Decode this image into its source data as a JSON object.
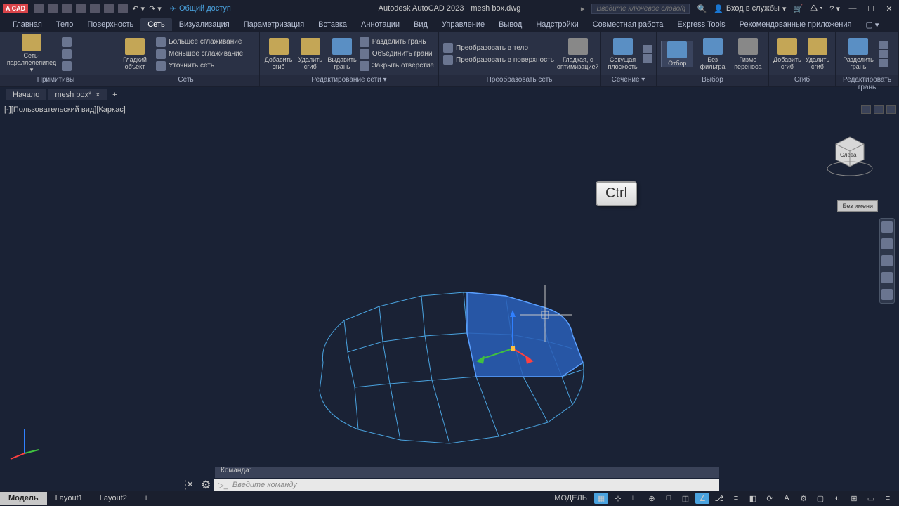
{
  "app": {
    "name": "Autodesk AutoCAD 2023",
    "file": "mesh box.dwg",
    "badge": "A CAD",
    "share": "Общий доступ",
    "search_placeholder": "Введите ключевое слово/фразу",
    "signin": "Вход в службы"
  },
  "ribbon_tabs": [
    "Главная",
    "Тело",
    "Поверхность",
    "Сеть",
    "Визуализация",
    "Параметризация",
    "Вставка",
    "Аннотации",
    "Вид",
    "Управление",
    "Вывод",
    "Надстройки",
    "Совместная работа",
    "Express Tools",
    "Рекомендованные приложения"
  ],
  "active_tab": 3,
  "panels": {
    "primitives": {
      "title": "Примитивы",
      "main_btn": "Сеть-параллелепипед"
    },
    "mesh": {
      "title": "Сеть",
      "smooth_obj": "Гладкий объект",
      "more": "Большее сглаживание",
      "less": "Меньшее сглаживание",
      "refine": "Уточнить сеть"
    },
    "edit": {
      "title": "Редактирование сети ▾",
      "add_crease": "Добавить сгиб",
      "del_crease": "Удалить сгиб",
      "extrude": "Выдавить грань",
      "split": "Разделить грань",
      "merge": "Объединить грани",
      "close_hole": "Закрыть отверстие"
    },
    "convert": {
      "title": "Преобразовать сеть",
      "smooth_opt": "Гладкая, с оптимизацией",
      "section": "Секущая плоскость",
      "to_solid": "Преобразовать в тело",
      "to_surf": "Преобразовать в поверхность"
    },
    "section_panel": {
      "title": "Сечение ▾"
    },
    "selection": {
      "title": "Выбор",
      "filter": "Отбор",
      "nofilter": "Без фильтра",
      "gizmo": "Гизмо переноса"
    },
    "crease": {
      "title": "Сгиб",
      "add": "Добавить сгиб",
      "del": "Удалить сгиб"
    },
    "edit_face": {
      "title": "Редактировать грань",
      "split": "Разделить грань"
    }
  },
  "doc_tabs": {
    "start": "Начало",
    "current": "mesh box*"
  },
  "viewport": {
    "label": "[-][Пользовательский вид][Каркас]",
    "cube_face": "Слева",
    "unnamed": "Без имени"
  },
  "key_hint": "Ctrl",
  "cmd": {
    "history": "Команда:",
    "placeholder": "Введите команду"
  },
  "layouts": [
    "Модель",
    "Layout1",
    "Layout2"
  ],
  "status": {
    "model": "МОДЕЛЬ"
  }
}
